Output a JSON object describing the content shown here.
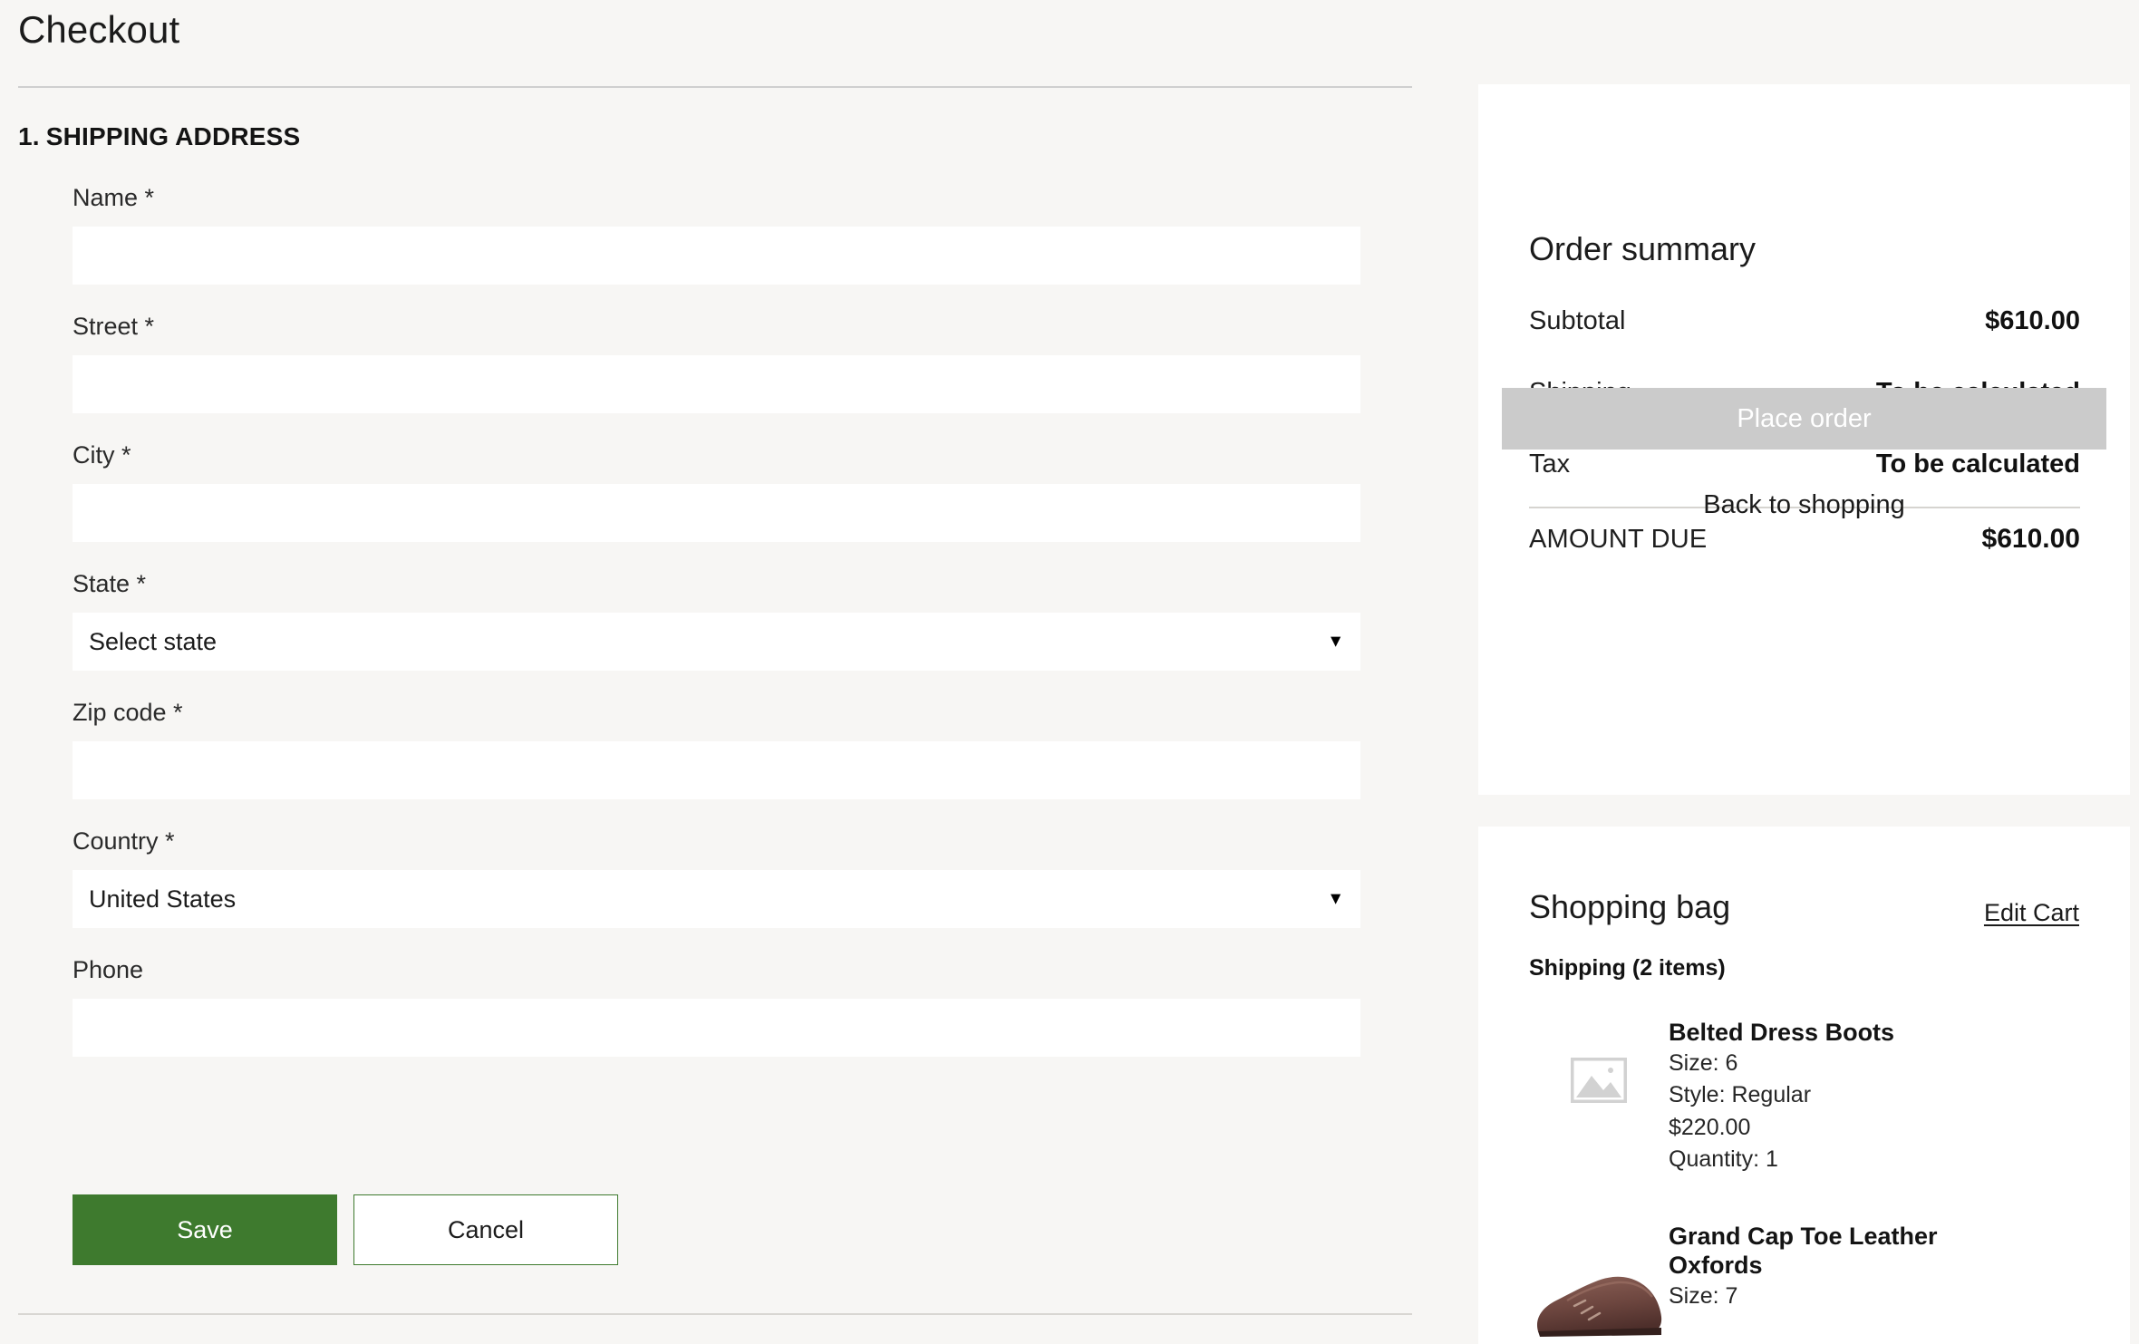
{
  "page": {
    "title": "Checkout"
  },
  "shipping_section": {
    "number": "1.",
    "heading": "SHIPPING ADDRESS",
    "fields": [
      {
        "label": "Name *",
        "type": "text",
        "value": "",
        "placeholder": ""
      },
      {
        "label": "Street *",
        "type": "text",
        "value": "",
        "placeholder": ""
      },
      {
        "label": "City *",
        "type": "text",
        "value": "",
        "placeholder": ""
      },
      {
        "label": "State *",
        "type": "select",
        "value": "Select state",
        "caret": "▼"
      },
      {
        "label": "Zip code *",
        "type": "text",
        "value": "",
        "placeholder": ""
      },
      {
        "label": "Country *",
        "type": "select",
        "value": "United States",
        "caret": "▼"
      },
      {
        "label": "Phone",
        "type": "text",
        "value": "",
        "placeholder": ""
      }
    ],
    "save_label": "Save",
    "cancel_label": "Cancel"
  },
  "order_summary": {
    "title": "Order summary",
    "rows": [
      {
        "label": "Subtotal",
        "value": "$610.00"
      },
      {
        "label": "Shipping",
        "value": "To be calculated"
      },
      {
        "label": "Tax",
        "value": "To be calculated"
      }
    ],
    "total": {
      "label": "AMOUNT DUE",
      "value": "$610.00"
    },
    "place_order_label": "Place order",
    "back_to_shopping_label": "Back to shopping"
  },
  "shopping_bag": {
    "title": "Shopping bag",
    "edit_cart_label": "Edit Cart",
    "shipping_count_label": "Shipping (2 items)",
    "items": [
      {
        "name": "Belted Dress Boots",
        "size": "Size: 6",
        "style": "Style: Regular",
        "price": "$220.00",
        "quantity": "Quantity: 1",
        "thumb": "image-placeholder-icon"
      },
      {
        "name": "Grand Cap Toe Leather Oxfords",
        "size": "Size: 7",
        "style": "",
        "price": "",
        "quantity": "",
        "thumb": "brown-oxford-shoe-photo"
      }
    ]
  },
  "colors": {
    "page_background": "#f7f6f4",
    "card_background": "#ffffff",
    "primary_green": "#3e7a2e",
    "disabled_gray": "#cbcbcb",
    "divider": "#cfcfcf",
    "text": "#1b1b1b"
  }
}
